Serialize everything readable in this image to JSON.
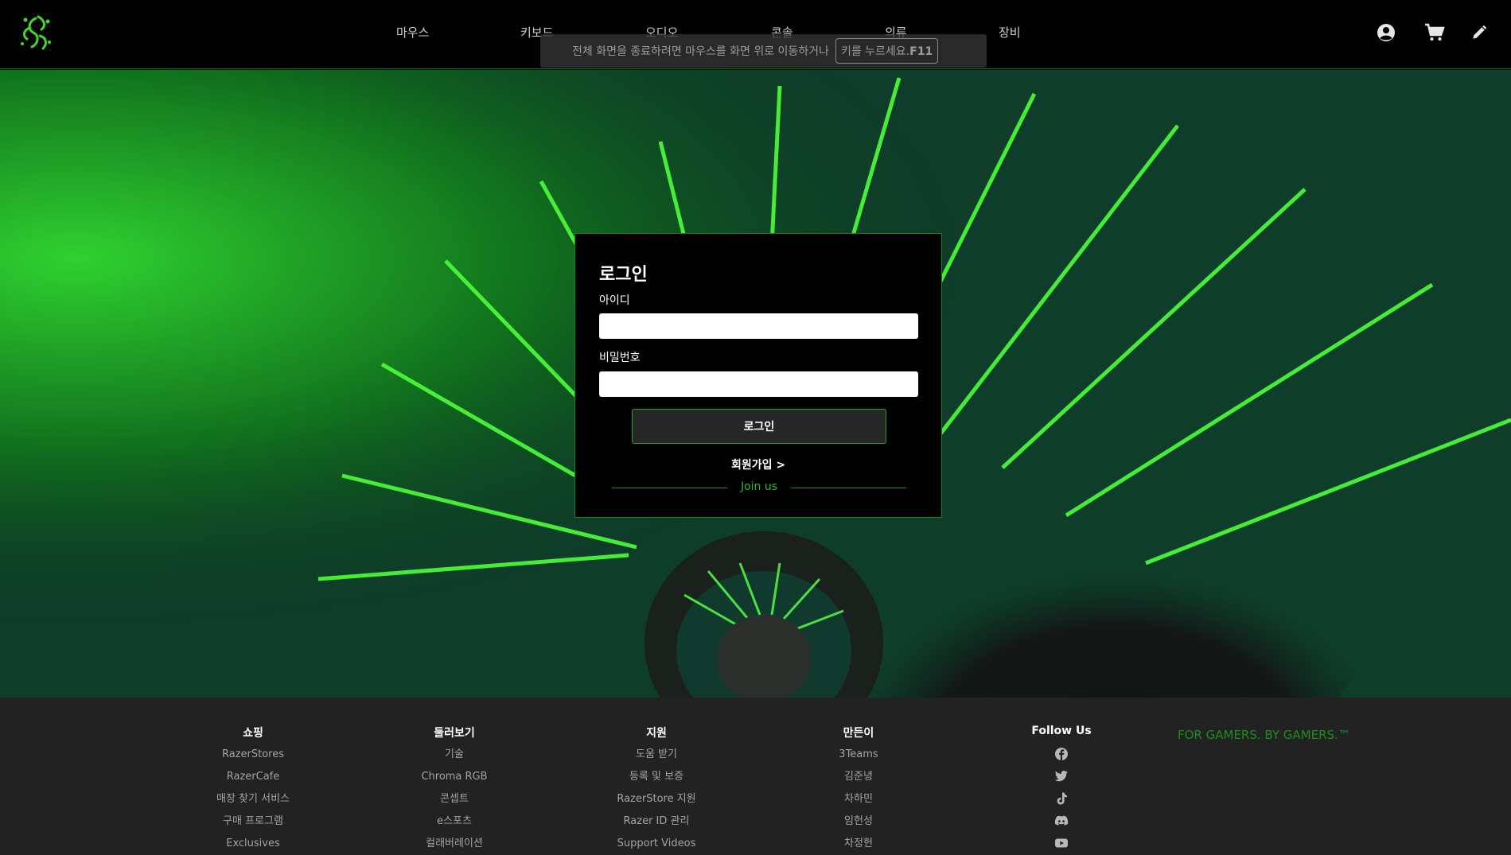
{
  "header": {
    "nav": [
      "마우스",
      "키보드",
      "오디오",
      "콘솔",
      "의류",
      "장비"
    ],
    "fullscreen_hint": {
      "text": "전체 화면을 종료하려면 마우스를 화면 위로 이동하거나",
      "key_text": "키를 누르세요.",
      "key": "F11"
    },
    "icons": [
      "account-icon",
      "cart-icon",
      "edit-icon"
    ]
  },
  "login": {
    "title": "로그인",
    "id_label": "아이디",
    "id_value": "",
    "password_label": "비밀번호",
    "password_value": "",
    "submit_label": "로그인",
    "signup_link": "회원가입 >",
    "join_text": "Join us"
  },
  "footer": {
    "columns": [
      {
        "title": "쇼핑",
        "items": [
          "RazerStores",
          "RazerCafe",
          "매장 찾기 서비스",
          "구매 프로그램",
          "Exclusives"
        ]
      },
      {
        "title": "둘러보기",
        "items": [
          "기술",
          "Chroma RGB",
          "콘셉트",
          "e스포츠",
          "컬래버레이션"
        ]
      },
      {
        "title": "지원",
        "items": [
          "도움 받기",
          "등록 및 보증",
          "RazerStore 지원",
          "Razer ID 관리",
          "Support Videos"
        ]
      },
      {
        "title": "만든이",
        "items": [
          "3Teams",
          "김준녕",
          "차하민",
          "임헌성",
          "차정헌"
        ]
      }
    ],
    "follow": {
      "title": "Follow Us",
      "icons": [
        "facebook-icon",
        "twitter-icon",
        "tiktok-icon",
        "discord-icon",
        "youtube-icon"
      ]
    },
    "tagline": "FOR GAMERS. BY GAMERS.™"
  },
  "colors": {
    "accent_green": "#44d62c",
    "border_green": "#1d7f1d",
    "footer_bg": "#222222",
    "header_bg": "#000000"
  }
}
